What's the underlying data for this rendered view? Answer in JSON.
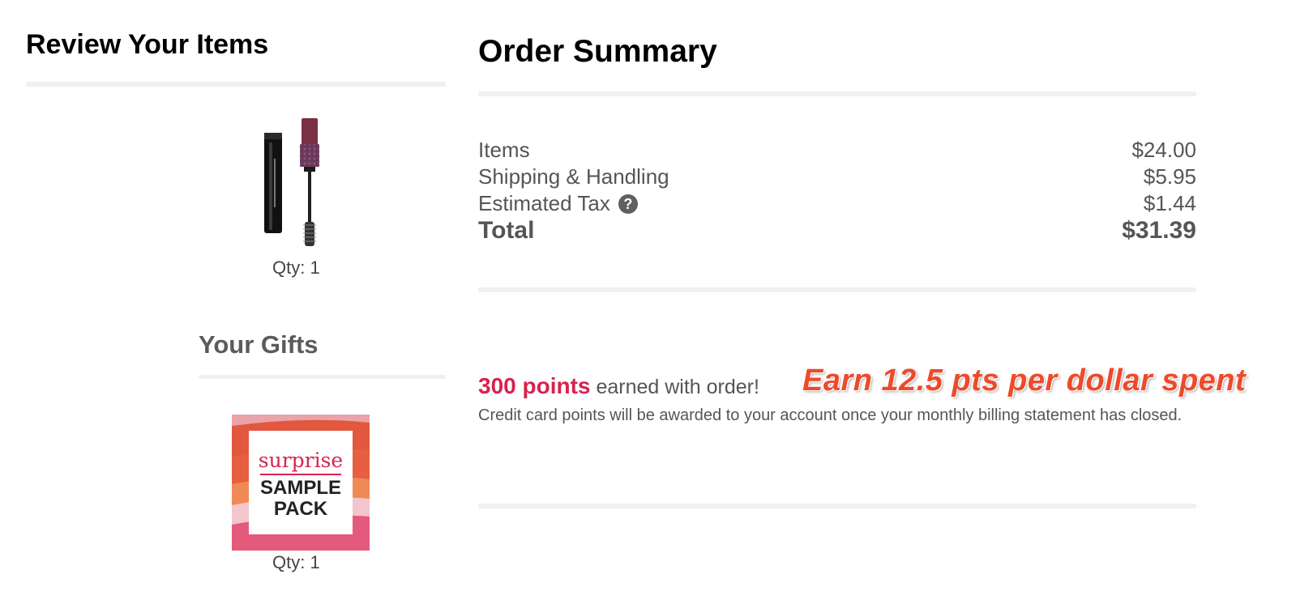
{
  "review": {
    "title": "Review Your Items",
    "product": {
      "name": "mascara-product-image",
      "qty": "Qty: 1"
    }
  },
  "gifts": {
    "title": "Your Gifts",
    "pack": {
      "surprise": "surprise",
      "sample": "SAMPLE",
      "pack": "PACK",
      "qty": "Qty: 1"
    }
  },
  "summary": {
    "title": "Order Summary",
    "rows": [
      {
        "label": "Items",
        "value": "$24.00"
      },
      {
        "label": "Shipping & Handling",
        "value": "$5.95"
      },
      {
        "label": "Estimated Tax",
        "value": "$1.44",
        "icon": "question-circle-icon"
      },
      {
        "label": "Total",
        "value": "$31.39"
      }
    ]
  },
  "points": {
    "amount": "300 points",
    "suffix": "earned with order!",
    "promo": "Earn 12.5 pts per dollar spent",
    "note": "Credit card points will be awarded to your account once your monthly billing statement has closed."
  },
  "colors": {
    "accent": "#d6234f",
    "promo": "#ee4a2a",
    "divider": "#f0f0f0"
  }
}
